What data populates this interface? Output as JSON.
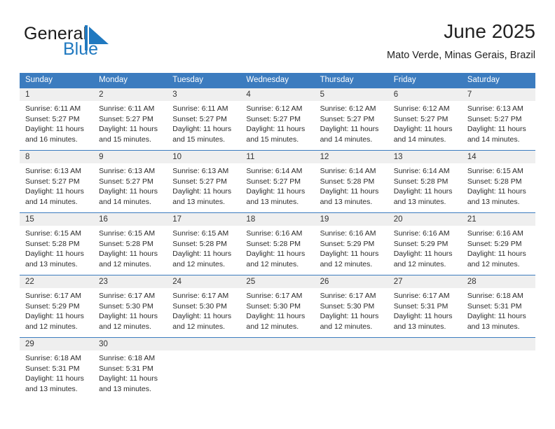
{
  "brand": {
    "name_part1": "General",
    "name_part2": "Blue",
    "mark": "blue-triangle-flag-icon"
  },
  "header": {
    "title": "June 2025",
    "subtitle": "Mato Verde, Minas Gerais, Brazil"
  },
  "colors": {
    "header_blue": "#3c7cbf",
    "brand_blue": "#2079c0",
    "day_band_gray": "#efefef",
    "text": "#222222"
  },
  "calendar": {
    "weekdays": [
      "Sunday",
      "Monday",
      "Tuesday",
      "Wednesday",
      "Thursday",
      "Friday",
      "Saturday"
    ],
    "weeks": [
      [
        {
          "day": "1",
          "sunrise": "Sunrise: 6:11 AM",
          "sunset": "Sunset: 5:27 PM",
          "daylight_line1": "Daylight: 11 hours",
          "daylight_line2": "and 16 minutes."
        },
        {
          "day": "2",
          "sunrise": "Sunrise: 6:11 AM",
          "sunset": "Sunset: 5:27 PM",
          "daylight_line1": "Daylight: 11 hours",
          "daylight_line2": "and 15 minutes."
        },
        {
          "day": "3",
          "sunrise": "Sunrise: 6:11 AM",
          "sunset": "Sunset: 5:27 PM",
          "daylight_line1": "Daylight: 11 hours",
          "daylight_line2": "and 15 minutes."
        },
        {
          "day": "4",
          "sunrise": "Sunrise: 6:12 AM",
          "sunset": "Sunset: 5:27 PM",
          "daylight_line1": "Daylight: 11 hours",
          "daylight_line2": "and 15 minutes."
        },
        {
          "day": "5",
          "sunrise": "Sunrise: 6:12 AM",
          "sunset": "Sunset: 5:27 PM",
          "daylight_line1": "Daylight: 11 hours",
          "daylight_line2": "and 14 minutes."
        },
        {
          "day": "6",
          "sunrise": "Sunrise: 6:12 AM",
          "sunset": "Sunset: 5:27 PM",
          "daylight_line1": "Daylight: 11 hours",
          "daylight_line2": "and 14 minutes."
        },
        {
          "day": "7",
          "sunrise": "Sunrise: 6:13 AM",
          "sunset": "Sunset: 5:27 PM",
          "daylight_line1": "Daylight: 11 hours",
          "daylight_line2": "and 14 minutes."
        }
      ],
      [
        {
          "day": "8",
          "sunrise": "Sunrise: 6:13 AM",
          "sunset": "Sunset: 5:27 PM",
          "daylight_line1": "Daylight: 11 hours",
          "daylight_line2": "and 14 minutes."
        },
        {
          "day": "9",
          "sunrise": "Sunrise: 6:13 AM",
          "sunset": "Sunset: 5:27 PM",
          "daylight_line1": "Daylight: 11 hours",
          "daylight_line2": "and 14 minutes."
        },
        {
          "day": "10",
          "sunrise": "Sunrise: 6:13 AM",
          "sunset": "Sunset: 5:27 PM",
          "daylight_line1": "Daylight: 11 hours",
          "daylight_line2": "and 13 minutes."
        },
        {
          "day": "11",
          "sunrise": "Sunrise: 6:14 AM",
          "sunset": "Sunset: 5:27 PM",
          "daylight_line1": "Daylight: 11 hours",
          "daylight_line2": "and 13 minutes."
        },
        {
          "day": "12",
          "sunrise": "Sunrise: 6:14 AM",
          "sunset": "Sunset: 5:28 PM",
          "daylight_line1": "Daylight: 11 hours",
          "daylight_line2": "and 13 minutes."
        },
        {
          "day": "13",
          "sunrise": "Sunrise: 6:14 AM",
          "sunset": "Sunset: 5:28 PM",
          "daylight_line1": "Daylight: 11 hours",
          "daylight_line2": "and 13 minutes."
        },
        {
          "day": "14",
          "sunrise": "Sunrise: 6:15 AM",
          "sunset": "Sunset: 5:28 PM",
          "daylight_line1": "Daylight: 11 hours",
          "daylight_line2": "and 13 minutes."
        }
      ],
      [
        {
          "day": "15",
          "sunrise": "Sunrise: 6:15 AM",
          "sunset": "Sunset: 5:28 PM",
          "daylight_line1": "Daylight: 11 hours",
          "daylight_line2": "and 13 minutes."
        },
        {
          "day": "16",
          "sunrise": "Sunrise: 6:15 AM",
          "sunset": "Sunset: 5:28 PM",
          "daylight_line1": "Daylight: 11 hours",
          "daylight_line2": "and 12 minutes."
        },
        {
          "day": "17",
          "sunrise": "Sunrise: 6:15 AM",
          "sunset": "Sunset: 5:28 PM",
          "daylight_line1": "Daylight: 11 hours",
          "daylight_line2": "and 12 minutes."
        },
        {
          "day": "18",
          "sunrise": "Sunrise: 6:16 AM",
          "sunset": "Sunset: 5:28 PM",
          "daylight_line1": "Daylight: 11 hours",
          "daylight_line2": "and 12 minutes."
        },
        {
          "day": "19",
          "sunrise": "Sunrise: 6:16 AM",
          "sunset": "Sunset: 5:29 PM",
          "daylight_line1": "Daylight: 11 hours",
          "daylight_line2": "and 12 minutes."
        },
        {
          "day": "20",
          "sunrise": "Sunrise: 6:16 AM",
          "sunset": "Sunset: 5:29 PM",
          "daylight_line1": "Daylight: 11 hours",
          "daylight_line2": "and 12 minutes."
        },
        {
          "day": "21",
          "sunrise": "Sunrise: 6:16 AM",
          "sunset": "Sunset: 5:29 PM",
          "daylight_line1": "Daylight: 11 hours",
          "daylight_line2": "and 12 minutes."
        }
      ],
      [
        {
          "day": "22",
          "sunrise": "Sunrise: 6:17 AM",
          "sunset": "Sunset: 5:29 PM",
          "daylight_line1": "Daylight: 11 hours",
          "daylight_line2": "and 12 minutes."
        },
        {
          "day": "23",
          "sunrise": "Sunrise: 6:17 AM",
          "sunset": "Sunset: 5:30 PM",
          "daylight_line1": "Daylight: 11 hours",
          "daylight_line2": "and 12 minutes."
        },
        {
          "day": "24",
          "sunrise": "Sunrise: 6:17 AM",
          "sunset": "Sunset: 5:30 PM",
          "daylight_line1": "Daylight: 11 hours",
          "daylight_line2": "and 12 minutes."
        },
        {
          "day": "25",
          "sunrise": "Sunrise: 6:17 AM",
          "sunset": "Sunset: 5:30 PM",
          "daylight_line1": "Daylight: 11 hours",
          "daylight_line2": "and 12 minutes."
        },
        {
          "day": "26",
          "sunrise": "Sunrise: 6:17 AM",
          "sunset": "Sunset: 5:30 PM",
          "daylight_line1": "Daylight: 11 hours",
          "daylight_line2": "and 12 minutes."
        },
        {
          "day": "27",
          "sunrise": "Sunrise: 6:17 AM",
          "sunset": "Sunset: 5:31 PM",
          "daylight_line1": "Daylight: 11 hours",
          "daylight_line2": "and 13 minutes."
        },
        {
          "day": "28",
          "sunrise": "Sunrise: 6:18 AM",
          "sunset": "Sunset: 5:31 PM",
          "daylight_line1": "Daylight: 11 hours",
          "daylight_line2": "and 13 minutes."
        }
      ],
      [
        {
          "day": "29",
          "sunrise": "Sunrise: 6:18 AM",
          "sunset": "Sunset: 5:31 PM",
          "daylight_line1": "Daylight: 11 hours",
          "daylight_line2": "and 13 minutes."
        },
        {
          "day": "30",
          "sunrise": "Sunrise: 6:18 AM",
          "sunset": "Sunset: 5:31 PM",
          "daylight_line1": "Daylight: 11 hours",
          "daylight_line2": "and 13 minutes."
        },
        {
          "day": "",
          "sunrise": "",
          "sunset": "",
          "daylight_line1": "",
          "daylight_line2": ""
        },
        {
          "day": "",
          "sunrise": "",
          "sunset": "",
          "daylight_line1": "",
          "daylight_line2": ""
        },
        {
          "day": "",
          "sunrise": "",
          "sunset": "",
          "daylight_line1": "",
          "daylight_line2": ""
        },
        {
          "day": "",
          "sunrise": "",
          "sunset": "",
          "daylight_line1": "",
          "daylight_line2": ""
        },
        {
          "day": "",
          "sunrise": "",
          "sunset": "",
          "daylight_line1": "",
          "daylight_line2": ""
        }
      ]
    ]
  }
}
